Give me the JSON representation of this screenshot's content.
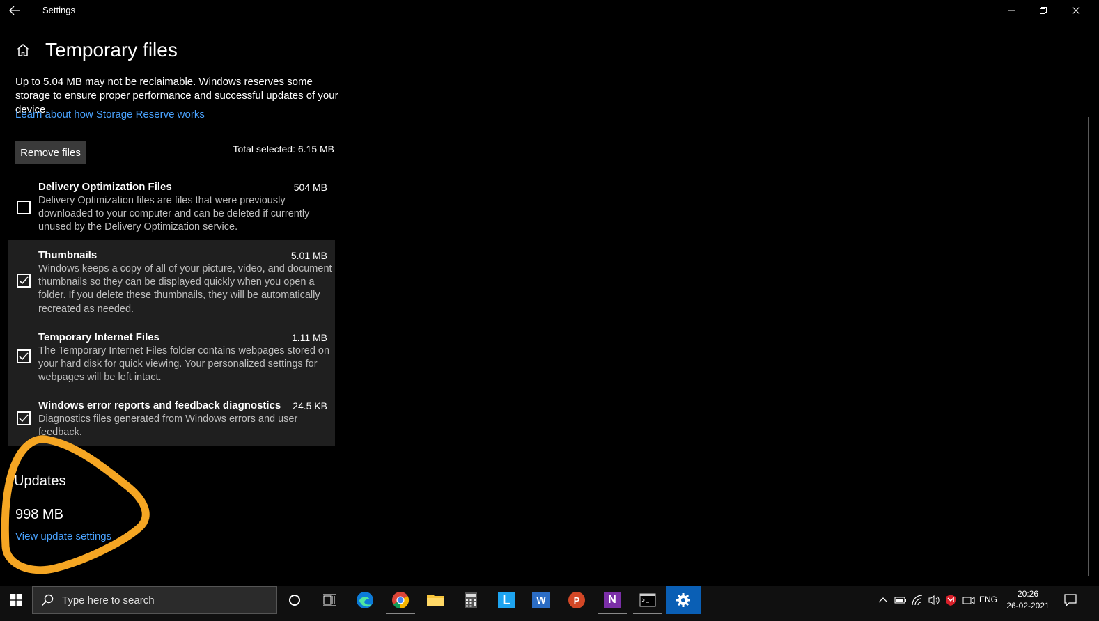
{
  "window": {
    "app_title": "Settings",
    "page_title": "Temporary files",
    "description": "Up to 5.04 MB may not be reclaimable. Windows reserves some storage to ensure proper performance and successful updates of your device.",
    "learn_link": "Learn about how Storage Reserve works",
    "remove_button": "Remove files",
    "total_selected": "Total selected: 6.15 MB"
  },
  "items": [
    {
      "name": "Delivery Optimization Files",
      "size": "504 MB",
      "checked": false,
      "description": "Delivery Optimization files are files that were previously downloaded to your computer and can be deleted if currently unused by the Delivery Optimization service."
    },
    {
      "name": "Thumbnails",
      "size": "5.01 MB",
      "checked": true,
      "description": "Windows keeps a copy of all of your picture, video, and document thumbnails so they can be displayed quickly when you open a folder. If you delete these thumbnails, they will be automatically recreated as needed."
    },
    {
      "name": "Temporary Internet Files",
      "size": "1.11 MB",
      "checked": true,
      "description": "The Temporary Internet Files folder contains webpages stored on your hard disk for quick viewing. Your personalized settings for webpages will be left intact."
    },
    {
      "name": "Windows error reports and feedback diagnostics",
      "size": "24.5 KB",
      "checked": true,
      "description": "Diagnostics files generated from Windows errors and user feedback."
    }
  ],
  "updates": {
    "title": "Updates",
    "size": "998 MB",
    "link": "View update settings"
  },
  "taskbar": {
    "search_placeholder": "Type here to search",
    "language": "ENG",
    "time": "20:26",
    "date": "26-02-2021",
    "onenote_letter": "N",
    "word_letter": "W",
    "ppt_letter": "P",
    "l_letter": "L"
  },
  "colors": {
    "accent_link": "#4aa3ff",
    "annotation": "#f5a623",
    "settings_active": "#0a5fb5"
  }
}
